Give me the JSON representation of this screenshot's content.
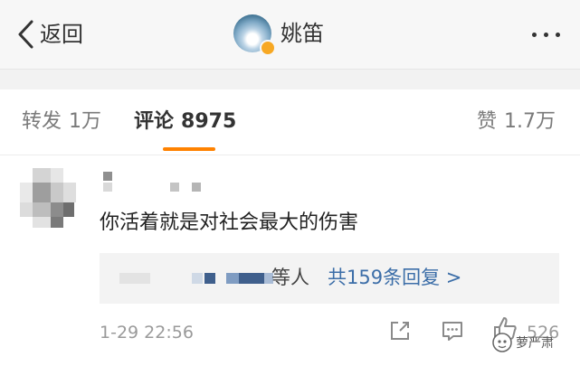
{
  "nav": {
    "back_label": "返回",
    "user_name": "姚笛"
  },
  "tabs": {
    "repost": {
      "label": "转发",
      "count": "1万"
    },
    "comment": {
      "label": "评论",
      "count": "8975"
    },
    "like": {
      "label": "赞",
      "count": "1.7万"
    }
  },
  "comment": {
    "text": "你活着就是对社会最大的伤害",
    "reply_others": "等人",
    "reply_link": "共159条回复 >",
    "timestamp": "1-29 22:56",
    "like_count": "526"
  },
  "watermark": {
    "text": "萝严肃"
  },
  "colors": {
    "accent": "#ff8200",
    "link": "#3c6ea8",
    "badge": "#f7a823"
  },
  "icons": [
    "chevron-left-icon",
    "more-dots-icon",
    "share-icon",
    "comment-icon",
    "like-icon"
  ]
}
